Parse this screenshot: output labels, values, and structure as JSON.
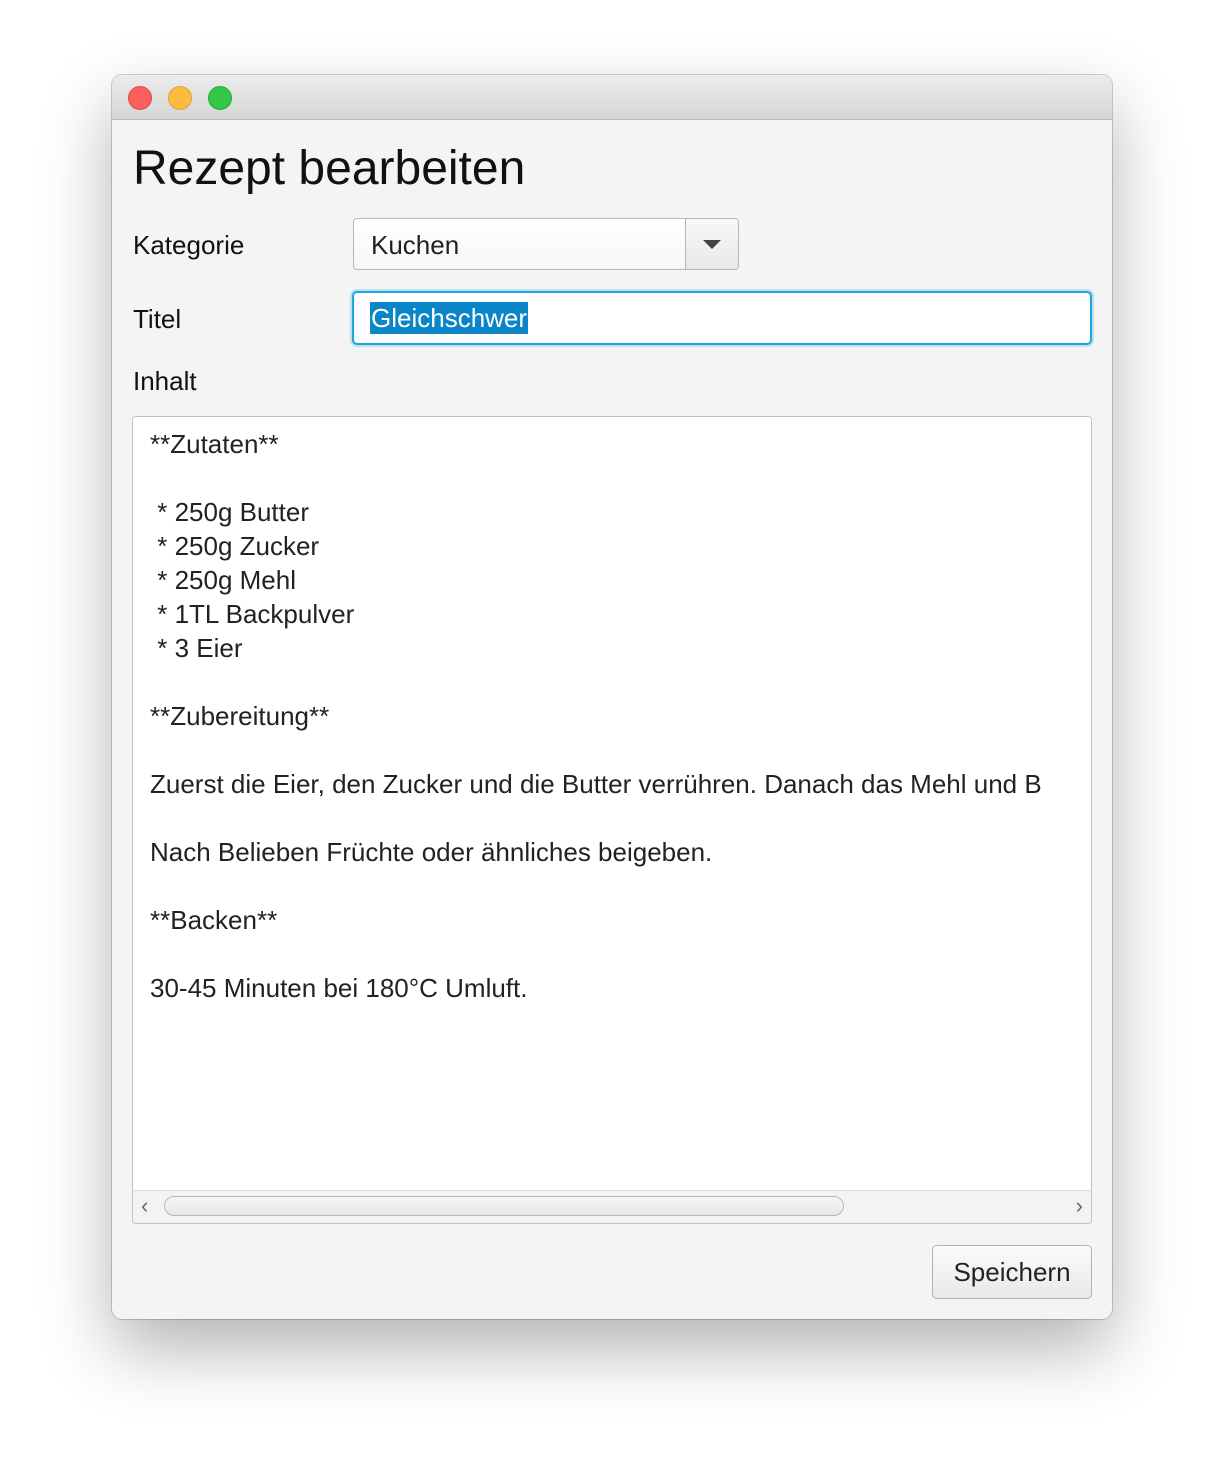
{
  "window": {
    "controls": {
      "close": "close-icon",
      "minimize": "minimize-icon",
      "maximize": "maximize-icon"
    }
  },
  "form": {
    "heading": "Rezept bearbeiten",
    "category_label": "Kategorie",
    "category_value": "Kuchen",
    "title_label": "Titel",
    "title_value": "Gleichschwer",
    "content_label": "Inhalt",
    "content_text": "**Zutaten**\n\n * 250g Butter\n * 250g Zucker\n * 250g Mehl\n * 1TL Backpulver\n * 3 Eier\n\n**Zubereitung**\n\nZuerst die Eier, den Zucker und die Butter verrühren. Danach das Mehl und B\n\nNach Belieben Früchte oder ähnliches beigeben.\n\n**Backen**\n\n30-45 Minuten bei 180°C Umluft.",
    "scroll_left": "‹",
    "scroll_right": "›",
    "save_label": "Speichern"
  },
  "colors": {
    "focus_ring": "#1ca5e0",
    "selection": "#0a86c8",
    "window_bg": "#f4f4f4"
  }
}
